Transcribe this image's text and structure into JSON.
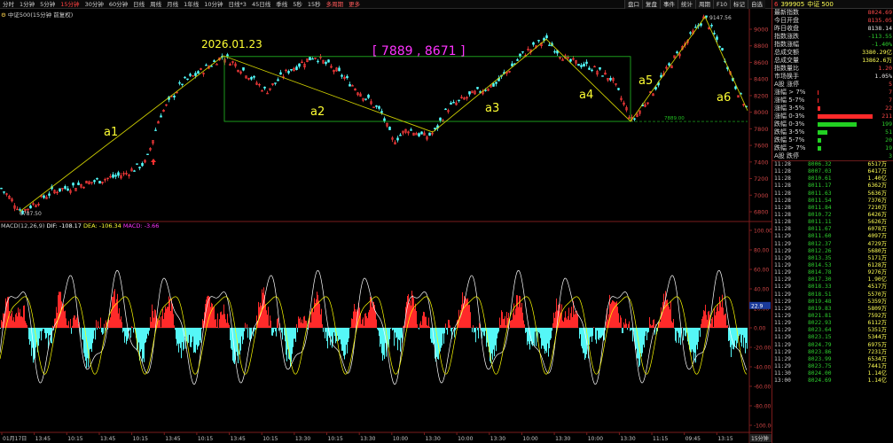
{
  "toolbar": {
    "items": [
      "分时",
      "1分钟",
      "5分钟",
      "15分钟",
      "30分钟",
      "60分钟",
      "日线",
      "周线",
      "月线",
      "1年线",
      "10分钟",
      "日线*3",
      "45日线",
      "季线",
      "5秒",
      "15秒",
      "多周期",
      "更多"
    ],
    "active": "15分钟",
    "right_tabs": [
      "盘口",
      "复盘",
      "事件",
      "统计",
      "周期",
      "F10",
      "标记",
      "自选"
    ]
  },
  "chart_title": {
    "index": "中证500",
    "period": "(15分钟 前复权)"
  },
  "main_chart": {
    "y_ticks": [
      "9000",
      "8800",
      "8600",
      "8400",
      "8200",
      "8000",
      "7800",
      "7600",
      "7400",
      "7200",
      "7000",
      "6800"
    ],
    "high_label": "9147.56",
    "low_label": "6787.50",
    "right_label": "7889.00",
    "date_annotation": "2026.01.23",
    "range_annotation": "[ 7889 , 8671 ]",
    "wave_labels": [
      "a1",
      "a2",
      "a3",
      "a4",
      "a5",
      "a6"
    ]
  },
  "macd": {
    "title": "MACD(12,26,9)",
    "dif": "DIF: -108.17",
    "dea": "DEA: -106.34",
    "macd": "MACD: -3.66",
    "y_ticks": [
      "100.00",
      "80.00",
      "60.00",
      "40.00",
      "20.00",
      "0.00",
      "-20.00",
      "-40.00",
      "-60.00",
      "-80.00",
      "-100.00"
    ],
    "marker": "22.9"
  },
  "time_axis": {
    "labels": [
      "01月17日",
      "13:45",
      "10:15",
      "13:45",
      "10:15",
      "13:45",
      "10:15",
      "13:45",
      "10:15",
      "13:30",
      "10:15",
      "13:30",
      "10:00",
      "13:30",
      "10:00",
      "13:30",
      "10:00",
      "13:30",
      "10:00",
      "13:30",
      "11:15",
      "09:45",
      "13:15"
    ],
    "period_tag": "15分钟"
  },
  "panel": {
    "index_id": "6",
    "code": "399905",
    "name": "中证 500",
    "quote_rows": [
      {
        "label": "最新指数",
        "value": "8024.69",
        "color": "red"
      },
      {
        "label": "今日开盘",
        "value": "8135.05",
        "color": "red"
      },
      {
        "label": "昨日收盘",
        "value": "8138.14",
        "color": "white"
      },
      {
        "label": "指数涨跌",
        "value": "-113.55",
        "color": "green"
      },
      {
        "label": "指数涨幅",
        "value": "-1.40%",
        "color": "green"
      },
      {
        "label": "总成交额",
        "value": "3380.29亿",
        "color": "yellow"
      },
      {
        "label": "总成交量",
        "value": "13862.6万",
        "color": "yellow"
      },
      {
        "label": "指数量比",
        "value": "1.20",
        "color": "red"
      },
      {
        "label": "市场换手",
        "value": "1.05%",
        "color": "white"
      }
    ],
    "breadth_rows": [
      {
        "label": "A股 涨停",
        "value": "5",
        "color": "red",
        "bar": 0
      },
      {
        "label": "涨幅 > 7%",
        "value": "7",
        "color": "red",
        "bar": 1
      },
      {
        "label": "涨幅 5-7%",
        "value": "7",
        "color": "red",
        "bar": 1
      },
      {
        "label": "涨幅 3-5%",
        "value": "22",
        "color": "red",
        "bar": 3
      },
      {
        "label": "涨幅 0-3%",
        "value": "211",
        "color": "red",
        "bar": 62
      },
      {
        "label": "跌幅 0-3%",
        "value": "199",
        "color": "green",
        "bar": 44
      },
      {
        "label": "跌幅 3-5%",
        "value": "51",
        "color": "green",
        "bar": 11
      },
      {
        "label": "跌幅 5-7%",
        "value": "20",
        "color": "green",
        "bar": 4
      },
      {
        "label": "跌幅 > 7%",
        "value": "19",
        "color": "green",
        "bar": 4
      },
      {
        "label": "A股 跌停",
        "value": "3",
        "color": "green",
        "bar": 0
      }
    ],
    "ticks": [
      {
        "time": "11:28",
        "price": "8006.32",
        "vol": "6517万"
      },
      {
        "time": "11:28",
        "price": "8007.03",
        "vol": "6417万"
      },
      {
        "time": "11:28",
        "price": "8010.61",
        "vol": "1.40亿"
      },
      {
        "time": "11:28",
        "price": "8011.17",
        "vol": "6362万"
      },
      {
        "time": "11:28",
        "price": "8011.63",
        "vol": "5636万"
      },
      {
        "time": "11:28",
        "price": "8011.54",
        "vol": "7376万"
      },
      {
        "time": "11:28",
        "price": "8011.84",
        "vol": "7210万"
      },
      {
        "time": "11:28",
        "price": "8010.72",
        "vol": "6426万"
      },
      {
        "time": "11:28",
        "price": "8011.11",
        "vol": "5626万"
      },
      {
        "time": "11:28",
        "price": "8011.67",
        "vol": "6078万"
      },
      {
        "time": "11:29",
        "price": "8011.60",
        "vol": "4097万"
      },
      {
        "time": "11:29",
        "price": "8012.37",
        "vol": "4729万"
      },
      {
        "time": "11:29",
        "price": "8012.26",
        "vol": "5680万"
      },
      {
        "time": "11:29",
        "price": "8013.35",
        "vol": "5171万"
      },
      {
        "time": "11:29",
        "price": "8014.53",
        "vol": "6128万"
      },
      {
        "time": "11:29",
        "price": "8014.78",
        "vol": "9276万"
      },
      {
        "time": "11:29",
        "price": "8017.30",
        "vol": "1.90亿"
      },
      {
        "time": "11:29",
        "price": "8018.33",
        "vol": "4517万"
      },
      {
        "time": "11:29",
        "price": "8018.51",
        "vol": "5570万"
      },
      {
        "time": "11:29",
        "price": "8019.48",
        "vol": "5359万"
      },
      {
        "time": "11:29",
        "price": "8019.83",
        "vol": "5809万"
      },
      {
        "time": "11:29",
        "price": "8021.81",
        "vol": "7592万"
      },
      {
        "time": "11:29",
        "price": "8022.93",
        "vol": "6112万"
      },
      {
        "time": "11:29",
        "price": "8023.64",
        "vol": "5351万"
      },
      {
        "time": "11:29",
        "price": "8023.15",
        "vol": "5344万"
      },
      {
        "time": "11:29",
        "price": "8024.79",
        "vol": "6975万"
      },
      {
        "time": "11:29",
        "price": "8023.86",
        "vol": "7231万"
      },
      {
        "time": "11:29",
        "price": "8023.99",
        "vol": "6534万"
      },
      {
        "time": "11:29",
        "price": "8023.75",
        "vol": "7441万"
      },
      {
        "time": "11:30",
        "price": "8024.00",
        "vol": "1.14亿"
      },
      {
        "time": "13:00",
        "price": "8024.69",
        "vol": "1.14亿"
      }
    ]
  },
  "colors": {
    "up": "#ff3c3c",
    "down": "#54fcfc",
    "dif": "#ffffff",
    "dea": "#ffff00",
    "box": "#22c022",
    "trend": "#cccc00",
    "annotation": "#ff33ff"
  }
}
